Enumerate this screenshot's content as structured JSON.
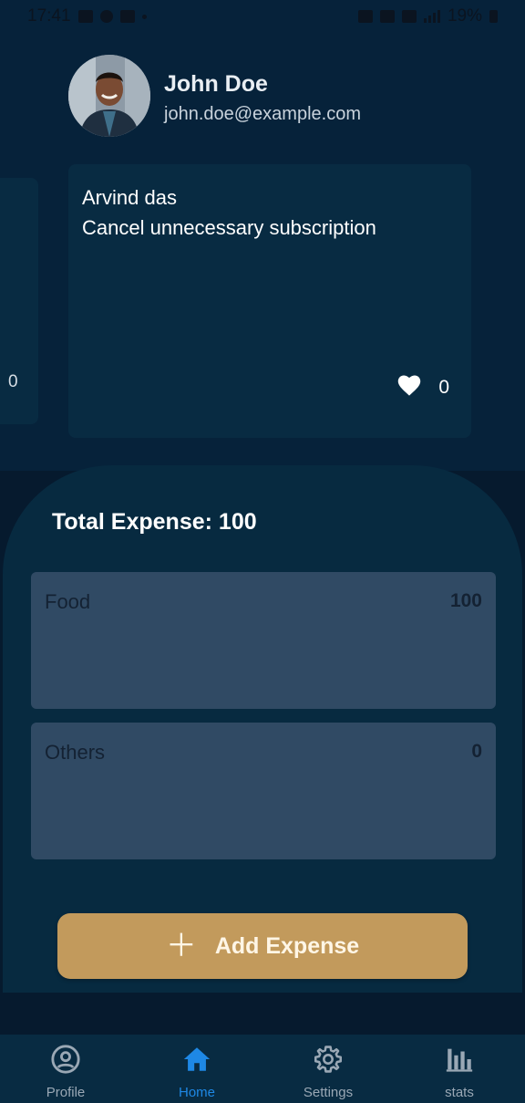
{
  "status_bar": {
    "time": "17:41",
    "battery": "19%"
  },
  "profile": {
    "name": "John Doe",
    "email": "john.doe@example.com"
  },
  "tips": {
    "peek_count": "0",
    "card": {
      "author": "Arvind das",
      "text": "Cancel unnecessary subscription",
      "likes": "0"
    }
  },
  "expenses": {
    "total_label": "Total Expense: 100",
    "categories": [
      {
        "name": "Food",
        "amount": "100"
      },
      {
        "name": "Others",
        "amount": "0"
      }
    ],
    "add_button_label": "Add Expense"
  },
  "nav": {
    "items": [
      {
        "label": "Profile",
        "icon": "profile-icon"
      },
      {
        "label": "Home",
        "icon": "home-icon",
        "active": true
      },
      {
        "label": "Settings",
        "icon": "gear-icon"
      },
      {
        "label": "stats",
        "icon": "bar-chart-icon"
      }
    ]
  },
  "colors": {
    "background": "#061a2e",
    "card": "#082b42",
    "category_card": "#304a64",
    "accent_button": "#c29a5c",
    "active_nav": "#1e88e5"
  }
}
